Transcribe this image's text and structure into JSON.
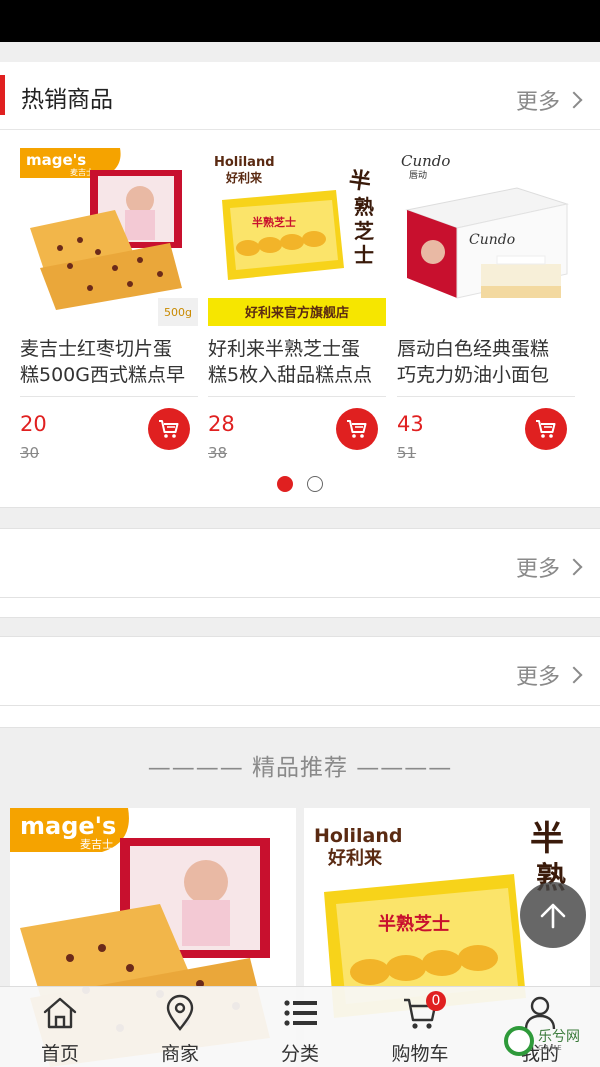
{
  "hot": {
    "title": "热销商品",
    "more": "更多",
    "products": [
      {
        "brand": "mage's",
        "brand_sub": "麦吉士",
        "name_line1": "麦吉士红枣切片蛋",
        "name_line2": "糕500G西式糕点早",
        "price": "20",
        "old_price": "30",
        "weight_tag": "500g"
      },
      {
        "brand": "Holiland",
        "brand_sub": "好利来",
        "name_line1": "好利来半熟芝士蛋",
        "name_line2": "糕5枚入甜品糕点点",
        "price": "28",
        "old_price": "38",
        "banner": "好利来官方旗舰店",
        "box_text": "半熟芝士"
      },
      {
        "brand": "Cundo",
        "brand_sub": "唇动",
        "name_line1": "唇动白色经典蛋糕",
        "name_line2": "巧克力奶油小面包",
        "price": "43",
        "old_price": "51"
      }
    ],
    "pager_pages": 2,
    "pager_active": 1
  },
  "section2": {
    "more": "更多"
  },
  "section3": {
    "more": "更多"
  },
  "recommend": {
    "heading": "———— 精品推荐 ————",
    "items": [
      {
        "brand": "mage's",
        "brand_sub": "麦吉士"
      },
      {
        "brand": "Holiland",
        "brand_sub": "好利来",
        "box_text": "半熟芝士"
      }
    ]
  },
  "nav": {
    "items": [
      {
        "label": "首页",
        "icon": "home-icon"
      },
      {
        "label": "商家",
        "icon": "location-pin-icon"
      },
      {
        "label": "分类",
        "icon": "list-icon"
      },
      {
        "label": "购物车",
        "icon": "cart-icon",
        "badge": "0"
      },
      {
        "label": "我的",
        "icon": "user-icon"
      }
    ]
  },
  "watermark": {
    "text": "乐兮网",
    "sub": "GAME"
  },
  "colors": {
    "accent": "#e02020",
    "muted": "#8a8a8a",
    "background": "#efefef"
  }
}
